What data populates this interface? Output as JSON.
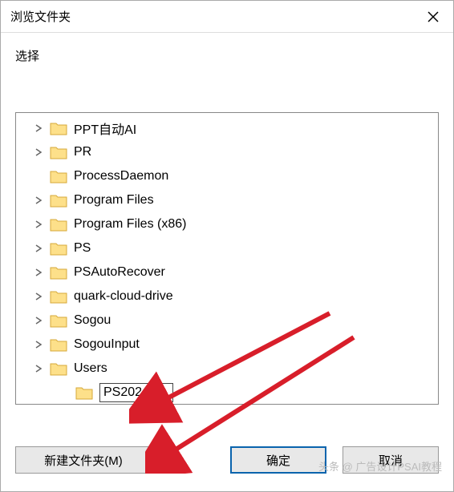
{
  "title": "浏览文件夹",
  "prompt": "选择",
  "folders": [
    "PPT自动AI",
    "PR",
    "ProcessDaemon",
    "Program Files",
    "Program Files (x86)",
    "PS",
    "PSAutoRecover",
    "quark-cloud-drive",
    "Sogou",
    "SogouInput",
    "Users"
  ],
  "new_folder_value": "PS2024",
  "buttons": {
    "new_folder": "新建文件夹(M)",
    "ok": "确定",
    "cancel": "取消"
  },
  "watermark": "头条 @ 广告设计PSAI教程"
}
